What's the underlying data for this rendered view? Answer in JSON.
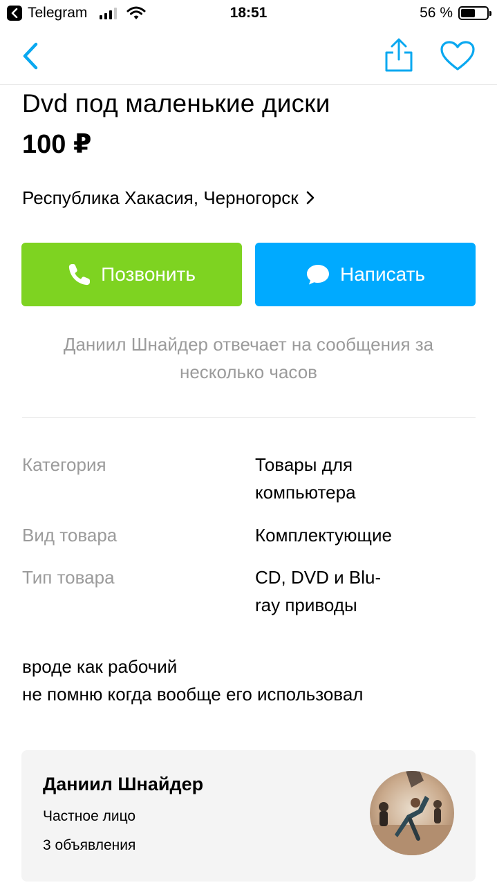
{
  "status_bar": {
    "back_app": "Telegram",
    "time": "18:51",
    "battery": "56 %",
    "battery_level": 0.56
  },
  "nav": {
    "back_icon": "chevron-left-icon",
    "share_icon": "share-icon",
    "favorite_icon": "heart-icon",
    "accent_color": "#0aa8f0"
  },
  "listing": {
    "title": "Dvd под маленькие диски",
    "price": "100 ₽",
    "location": "Республика Хакасия, Черногорск"
  },
  "actions": {
    "call_label": "Позвонить",
    "call_color": "#7ed321",
    "write_label": "Написать",
    "write_color": "#00aaff"
  },
  "response_note": "Даниил Шнайдер отвечает на сообщения за несколько часов",
  "params": [
    {
      "label": "Категория",
      "value_lines": [
        "Товары для",
        "компьютера"
      ]
    },
    {
      "label": "Вид товара",
      "value_lines": [
        "Комплектующие"
      ]
    },
    {
      "label": "Тип товара",
      "value_lines": [
        "CD, DVD и Blu-",
        "ray приводы"
      ]
    }
  ],
  "description": {
    "lines": [
      "вроде как рабочий",
      "не помню когда вообще его использовал"
    ]
  },
  "seller": {
    "name": "Даниил Шнайдер",
    "type": "Частное лицо",
    "ads_count": "3 объявления"
  }
}
